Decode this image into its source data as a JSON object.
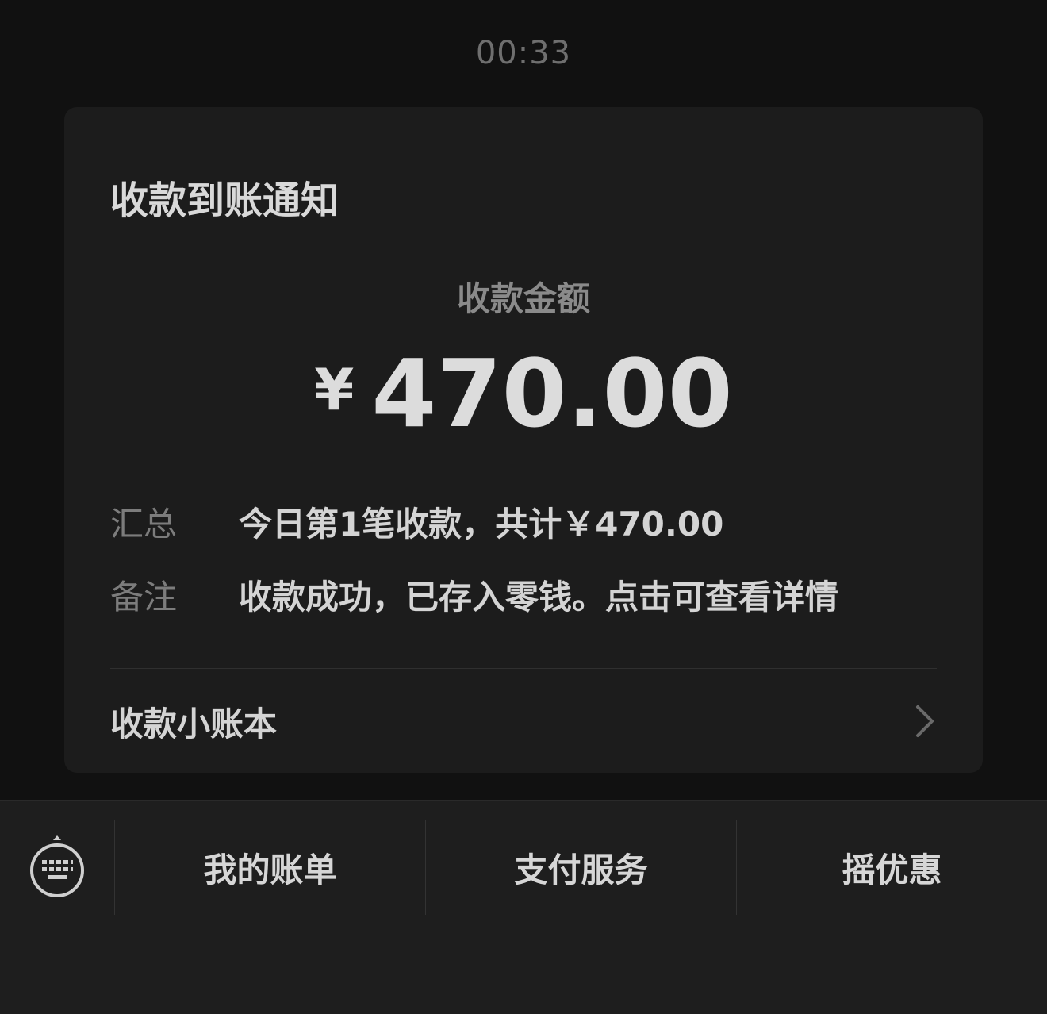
{
  "timestamp": "00:33",
  "card": {
    "title": "收款到账通知",
    "amount_label": "收款金额",
    "currency_symbol": "¥",
    "amount": "470.00",
    "rows": [
      {
        "label": "汇总",
        "value": "今日第1笔收款，共计￥470.00"
      },
      {
        "label": "备注",
        "value": "收款成功，已存入零钱。点击可查看详情"
      }
    ],
    "ledger_label": "收款小账本"
  },
  "menu": {
    "items": [
      {
        "label": "我的账单"
      },
      {
        "label": "支付服务"
      },
      {
        "label": "摇优惠"
      }
    ]
  },
  "icons": {
    "keyboard": "keyboard-icon",
    "chevron": "chevron-right-icon"
  }
}
